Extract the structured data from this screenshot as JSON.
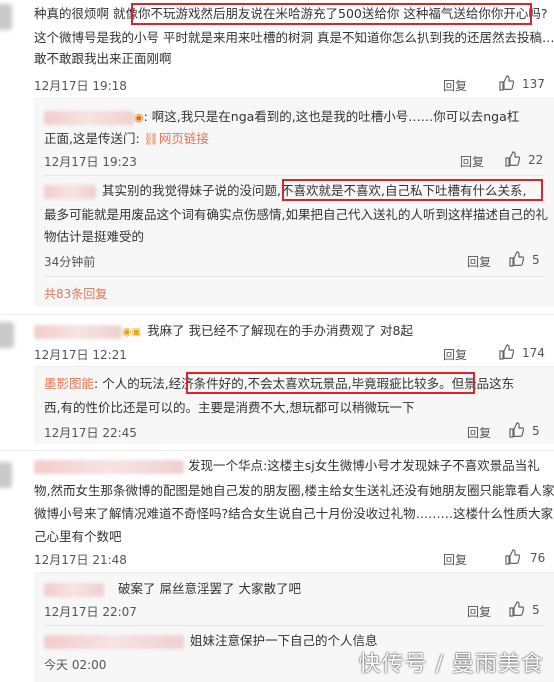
{
  "c1": {
    "line1a": "种真的很烦啊 就像",
    "line1b": "你不玩游戏然后朋友说在米哈游充了500送给你 这种福气送给你你开心吗?",
    "line1c": "5",
    "line2": "这个微博号是我的小号 平时就是来用来吐槽的树洞 真是不知道你怎么扒到我的还居然去投稿…你",
    "line3": "敢不敢跟我出来正面刚啊",
    "time": "12月17日 19:18",
    "reply": "回复",
    "likes": "137"
  },
  "r1": {
    "line1": ": 啊这,我只是在nga看到的,这也是我的吐槽小号……你可以去nga杠",
    "line2": "正面,这是传送门:",
    "link": "网页链接",
    "time": "12月17日 19:23",
    "reply": "回复",
    "likes": "22"
  },
  "r2": {
    "line1a": "其实别的我觉得妹子说的没问题,",
    "line1b": "不喜欢就是不喜欢,自己私下吐槽有什么关系,",
    "line2": "最多可能就是用废品这个词有确实点伤感情,如果把自己代入送礼的人听到这样描述自己的礼",
    "line3": "物估计是挺难受的",
    "time": "34分钟前",
    "reply": "回复",
    "likes": "5"
  },
  "c1_more": "共83条回复",
  "c2": {
    "line1": "我麻了 我已经不了解现在的手办消费观了 对8起",
    "time": "12月17日 12:21",
    "reply": "回复",
    "likes": "174"
  },
  "r3": {
    "name": "墨影图能",
    "line1a": ": 个人的玩法,",
    "line1b": "经济条件好的,不会太喜欢玩景品,毕竟瑕疵比较多。",
    "line1c": "但景品这东",
    "line2": "西,有的性价比还是可以的。主要是消费不大,想玩都可以稍微玩一下",
    "time": "12月17日 22:45",
    "reply": "回复",
    "likes": "5"
  },
  "c3": {
    "line1": "发现一个华点:这楼主sj女生微博小号才发现妹子不喜欢景品当礼",
    "line2": "物,然而女生那条微博的配图是她自己发的朋友圈,楼主给女生送礼还没有她朋友圈只能靠看人家",
    "line3": "微博小号来了解情况难道不奇怪吗?结合女生说自己十月份没收过礼物………这楼什么性质大家自",
    "line4": "己心里有个数吧",
    "time": "12月17日 21:48",
    "reply": "回复",
    "likes": "76"
  },
  "r4": {
    "line1": "破案了 屌丝意淫罢了 大家散了吧",
    "time": "12月17日 22:07",
    "reply": "回复",
    "likes": "5"
  },
  "r5": {
    "line1": "姐妹注意保护一下自己的个人信息",
    "time": "今天 02:00"
  },
  "watermark": "快传号 / 曼雨美食"
}
